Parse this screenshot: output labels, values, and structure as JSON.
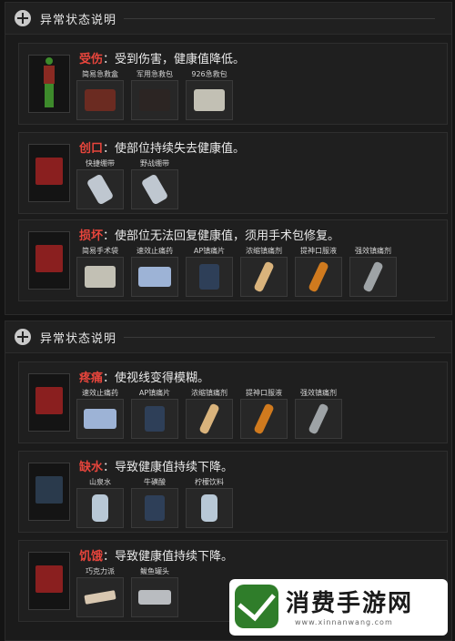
{
  "panels": [
    {
      "title": "异常状态说明",
      "statuses": [
        {
          "name": "受伤",
          "description": "：受到伤害，健康值降低。",
          "icon": "injured-body-icon",
          "items": [
            {
              "label": "简易急救盒",
              "icon": "first-aid-box-icon"
            },
            {
              "label": "军用急救包",
              "icon": "military-first-aid-kit-icon"
            },
            {
              "label": "926急救包",
              "icon": "first-aid-pack-icon"
            }
          ]
        },
        {
          "name": "创口",
          "description": "：使部位持续失去健康值。",
          "icon": "wound-icon",
          "items": [
            {
              "label": "快捷绷带",
              "icon": "bandage-icon"
            },
            {
              "label": "野战绷带",
              "icon": "field-bandage-icon"
            }
          ]
        },
        {
          "name": "损坏",
          "description": "：使部位无法回复健康值，须用手术包修复。",
          "icon": "broken-limb-icon",
          "items": [
            {
              "label": "简易手术袋",
              "icon": "surgical-kit-icon"
            },
            {
              "label": "速效止痛药",
              "icon": "painkiller-pills-icon"
            },
            {
              "label": "AP镇痛片",
              "icon": "ap-painkiller-can-icon"
            },
            {
              "label": "浓缩镇痛剂",
              "icon": "concentrated-analgesic-icon"
            },
            {
              "label": "提神口服液",
              "icon": "stimulant-oral-liquid-icon"
            },
            {
              "label": "强效镇痛剂",
              "icon": "strong-analgesic-icon"
            }
          ]
        }
      ]
    },
    {
      "title": "异常状态说明",
      "statuses": [
        {
          "name": "疼痛",
          "description": "：使视线变得模糊。",
          "icon": "pain-body-icon",
          "items": [
            {
              "label": "速效止痛药",
              "icon": "painkiller-pills-icon"
            },
            {
              "label": "AP镇痛片",
              "icon": "ap-painkiller-can-icon"
            },
            {
              "label": "浓缩镇痛剂",
              "icon": "concentrated-analgesic-icon"
            },
            {
              "label": "提神口服液",
              "icon": "stimulant-oral-liquid-icon"
            },
            {
              "label": "强效镇痛剂",
              "icon": "strong-analgesic-icon"
            }
          ]
        },
        {
          "name": "缺水",
          "description": "：导致健康值持续下降。",
          "icon": "water-drop-icon",
          "items": [
            {
              "label": "山泉水",
              "icon": "water-bottle-icon"
            },
            {
              "label": "牛磺酸",
              "icon": "taurine-can-icon"
            },
            {
              "label": "柠檬饮料",
              "icon": "lemon-drink-icon"
            }
          ]
        },
        {
          "name": "饥饿",
          "description": "：导致健康值持续下降。",
          "icon": "stomach-icon",
          "items": [
            {
              "label": "巧克力派",
              "icon": "chocolate-pie-icon"
            },
            {
              "label": "鲅鱼罐头",
              "icon": "canned-fish-icon"
            }
          ]
        }
      ]
    }
  ],
  "watermark": {
    "title": "消费手游网",
    "url": "www.xinnanwang.com"
  },
  "colors": {
    "status_name": "#e8453c",
    "background": "#141414"
  }
}
